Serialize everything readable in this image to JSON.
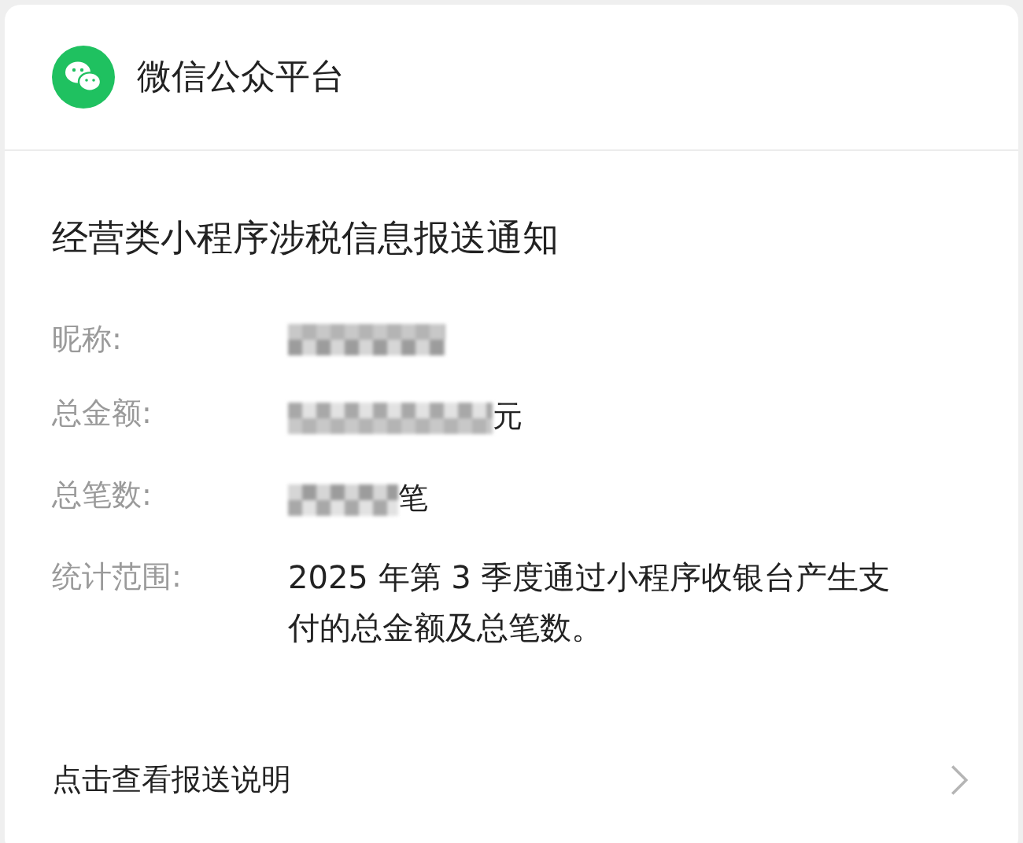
{
  "header": {
    "account": "微信公众平台"
  },
  "notice": {
    "title": "经营类小程序涉税信息报送通知",
    "fields": [
      {
        "label": "昵称:",
        "value_hidden": true
      },
      {
        "label": "总金额:",
        "value_hidden": true,
        "unit": "元"
      },
      {
        "label": "总笔数:",
        "value_hidden": true,
        "unit": "笔"
      },
      {
        "label": "统计范围:",
        "value_hidden": false,
        "value": "2025 年第 3 季度通过小程序收银台产生支付的总金额及总笔数。"
      }
    ]
  },
  "footer": {
    "link": "点击查看报送说明"
  }
}
